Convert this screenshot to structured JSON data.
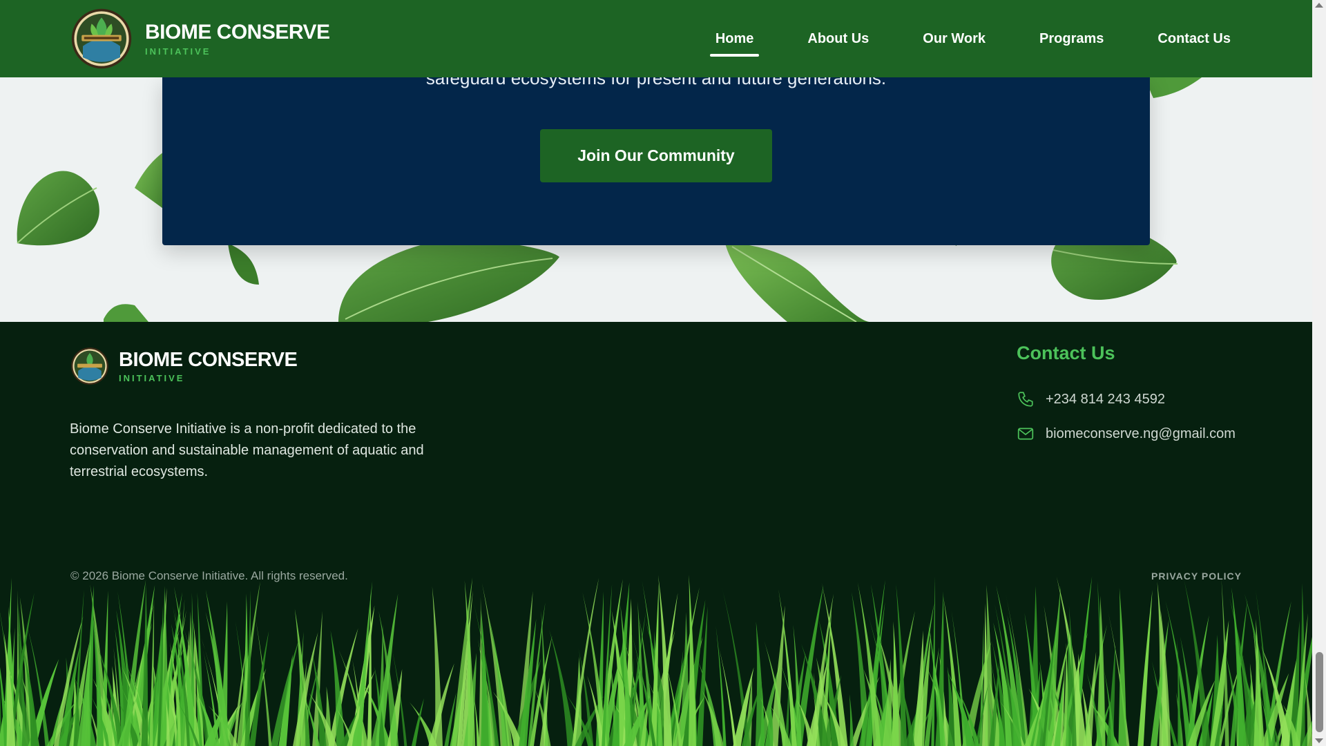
{
  "nav": {
    "brand_name": "BIOME CONSERVE",
    "brand_sub": "INITIATIVE",
    "items": [
      {
        "label": "Home",
        "active": true
      },
      {
        "label": "About Us",
        "active": false
      },
      {
        "label": "Our Work",
        "active": false
      },
      {
        "label": "Programs",
        "active": false
      },
      {
        "label": "Contact Us",
        "active": false
      }
    ]
  },
  "cta": {
    "text": "safeguard ecosystems for present and future generations.",
    "button": "Join Our Community"
  },
  "footer": {
    "brand_name": "BIOME CONSERVE",
    "brand_sub": "INITIATIVE",
    "description": "Biome Conserve Initiative is a non-profit dedicated to the conservation and sustainable management of aquatic and terrestrial ecosystems.",
    "contact_title": "Contact Us",
    "phone": "+234 814 243 4592",
    "email": "biomeconserve.ng@gmail.com",
    "copyright": "© 2026 Biome Conserve Initiative. All rights reserved.",
    "privacy": "PRIVACY POLICY"
  },
  "colors": {
    "nav_bg": "#1d6424",
    "cta_bg": "#03264a",
    "footer_bg": "#06200f",
    "accent_green": "#4cc25a"
  },
  "icons": {
    "phone": "phone-icon",
    "email": "mail-icon"
  }
}
